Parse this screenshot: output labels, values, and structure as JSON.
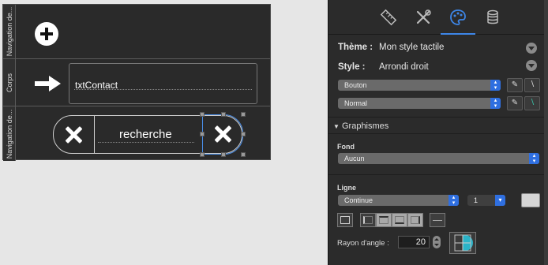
{
  "canvas": {
    "bands": [
      {
        "label": "Navigation de..."
      },
      {
        "label": "Corps"
      },
      {
        "label": "Navigation de..."
      }
    ],
    "contact_field": {
      "text": "txtContact"
    },
    "search": {
      "text": "recherche"
    }
  },
  "inspector": {
    "tabs": [
      {
        "icon": "ruler-icon"
      },
      {
        "icon": "tools-icon"
      },
      {
        "icon": "palette-icon",
        "active": true
      },
      {
        "icon": "database-icon"
      }
    ],
    "theme": {
      "label": "Thème :",
      "value": "Mon style tactile"
    },
    "style": {
      "label": "Style :",
      "value": "Arrondi droit"
    },
    "type_select": {
      "value": "Bouton"
    },
    "state_select": {
      "value": "Normal"
    },
    "graphismes": {
      "title": "Graphismes"
    },
    "fond": {
      "label": "Fond",
      "value": "Aucun"
    },
    "ligne": {
      "label": "Ligne",
      "style_value": "Continue",
      "width_value": "1"
    },
    "corner": {
      "label": "Rayon d'angle :",
      "value": "20"
    },
    "accent": "#3d86e8",
    "select_accent": "#2f6fe0"
  }
}
